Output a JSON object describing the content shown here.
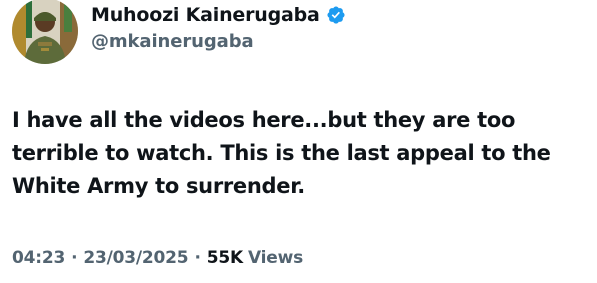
{
  "tweet": {
    "author": {
      "display_name": "Muhoozi Kainerugaba",
      "handle": "@mkainerugaba",
      "verified": true,
      "avatar_icon": "profile-avatar"
    },
    "text": "I have all the videos here...but they are too terrible to watch. This is the last appeal to the White Army to surrender.",
    "meta": {
      "time": "04:23",
      "separator": "·",
      "date": "23/03/2025",
      "views_count": "55K",
      "views_label": "Views"
    }
  },
  "colors": {
    "text_primary": "#0f1419",
    "text_secondary": "#536471",
    "verified_blue": "#1d9bf0",
    "background": "#ffffff"
  }
}
